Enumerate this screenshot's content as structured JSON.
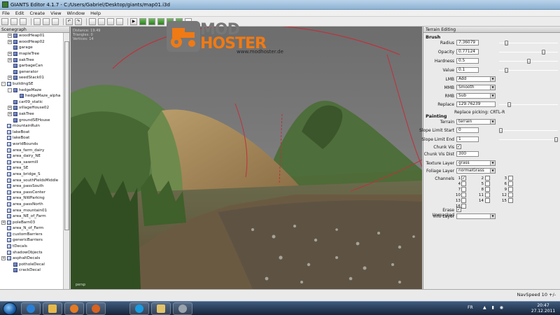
{
  "window": {
    "title": "GIANTS Editor 4.1.7 - C:/Users/Gabriel/Desktop/giants/map01.i3d"
  },
  "menu": [
    "File",
    "Edit",
    "Create",
    "View",
    "Window",
    "Help"
  ],
  "toolbar": {
    "icons": [
      "new-icon",
      "open-icon",
      "save-icon",
      "cut-icon",
      "copy-icon",
      "paste-icon",
      "undo-icon",
      "redo-icon",
      "select-icon",
      "move-icon",
      "rotate-icon",
      "scale-icon",
      "play-icon",
      "terrain-sculpt-icon",
      "terrain-paint-icon",
      "foliage-icon",
      "texture-icon",
      "grid-icon",
      "camera-icon"
    ]
  },
  "scenegraph": {
    "title": "Scenegraph",
    "items": [
      {
        "label": "woodHeap01",
        "indent": 1,
        "expander": "+",
        "icon": "node-icon"
      },
      {
        "label": "woodHeap02",
        "indent": 1,
        "expander": "+",
        "icon": "node-icon"
      },
      {
        "label": "garage",
        "indent": 1,
        "expander": "",
        "icon": "node-icon"
      },
      {
        "label": "mapleTree",
        "indent": 1,
        "expander": "+",
        "icon": "node-icon"
      },
      {
        "label": "oakTree",
        "indent": 1,
        "expander": "+",
        "icon": "node-icon"
      },
      {
        "label": "garbageCan",
        "indent": 1,
        "expander": "",
        "icon": "node-icon"
      },
      {
        "label": "generator",
        "indent": 1,
        "expander": "",
        "icon": "node-icon"
      },
      {
        "label": "seedStack01",
        "indent": 1,
        "expander": "+",
        "icon": "node-icon"
      },
      {
        "label": "buildingSE",
        "indent": 0,
        "expander": "-",
        "icon": "group-icon"
      },
      {
        "label": "hedgeMaze",
        "indent": 1,
        "expander": "-",
        "icon": "node-icon"
      },
      {
        "label": "hedgeMaze_alpha",
        "indent": 2,
        "expander": "",
        "icon": "node-icon"
      },
      {
        "label": "car09_static",
        "indent": 1,
        "expander": "",
        "icon": "node-icon"
      },
      {
        "label": "villageHouse02",
        "indent": 1,
        "expander": "+",
        "icon": "node-icon"
      },
      {
        "label": "oakTree",
        "indent": 1,
        "expander": "+",
        "icon": "node-icon"
      },
      {
        "label": "groundSEHouse",
        "indent": 1,
        "expander": "",
        "icon": "node-icon"
      },
      {
        "label": "mountainRuin",
        "indent": 0,
        "expander": "",
        "icon": "group-icon"
      },
      {
        "label": "lakeBoat",
        "indent": 0,
        "expander": "",
        "icon": "group-icon"
      },
      {
        "label": "lakeBoat",
        "indent": 0,
        "expander": "",
        "icon": "group-icon"
      },
      {
        "label": "worldBounds",
        "indent": 0,
        "expander": "",
        "icon": "group-icon"
      },
      {
        "label": "area_farm_dairy",
        "indent": 0,
        "expander": "",
        "icon": "group-icon"
      },
      {
        "label": "area_dairy_NE",
        "indent": 0,
        "expander": "",
        "icon": "group-icon"
      },
      {
        "label": "area_sawmill",
        "indent": 0,
        "expander": "",
        "icon": "group-icon"
      },
      {
        "label": "area_SE",
        "indent": 0,
        "expander": "",
        "icon": "group-icon"
      },
      {
        "label": "area_bridge_S",
        "indent": 0,
        "expander": "",
        "icon": "group-icon"
      },
      {
        "label": "area_southFieldsMiddle",
        "indent": 0,
        "expander": "",
        "icon": "group-icon"
      },
      {
        "label": "area_passSouth",
        "indent": 0,
        "expander": "",
        "icon": "group-icon"
      },
      {
        "label": "area_passCenter",
        "indent": 0,
        "expander": "",
        "icon": "group-icon"
      },
      {
        "label": "area_NWParking",
        "indent": 0,
        "expander": "",
        "icon": "group-icon"
      },
      {
        "label": "area_passNorth",
        "indent": 0,
        "expander": "",
        "icon": "group-icon"
      },
      {
        "label": "area_mountain01",
        "indent": 0,
        "expander": "",
        "icon": "group-icon"
      },
      {
        "label": "area_NE_of_Farm",
        "indent": 0,
        "expander": "",
        "icon": "group-icon"
      },
      {
        "label": "poleBarn03",
        "indent": 0,
        "expander": "+",
        "icon": "group-icon"
      },
      {
        "label": "area_N_of_Farm",
        "indent": 0,
        "expander": "",
        "icon": "group-icon"
      },
      {
        "label": "customBarriers",
        "indent": 0,
        "expander": "",
        "icon": "group-icon"
      },
      {
        "label": "genericBarriers",
        "indent": 0,
        "expander": "",
        "icon": "group-icon"
      },
      {
        "label": "tDecals",
        "indent": 0,
        "expander": "",
        "icon": "group-icon"
      },
      {
        "label": "shadowObjects",
        "indent": 0,
        "expander": "",
        "icon": "group-icon"
      },
      {
        "label": "asphaltDecals",
        "indent": 0,
        "expander": "+",
        "icon": "group-icon"
      },
      {
        "label": "potholeDecal",
        "indent": 1,
        "expander": "",
        "icon": "node-icon"
      },
      {
        "label": "crackDecal",
        "indent": 1,
        "expander": "",
        "icon": "node-icon"
      }
    ]
  },
  "viewport": {
    "stats": [
      "Distance: 19.49",
      "Triangles: 0",
      "Vertices: 14"
    ],
    "camera_label": "persp"
  },
  "watermark": {
    "mod": "MOD",
    "hoster": "HOSTER",
    "url": "www.modhoster.de"
  },
  "terrain": {
    "title": "Terrain Editing",
    "brush": {
      "section": "Brush",
      "radius_label": "Radius",
      "radius": "7.36079",
      "opacity_label": "Opacity",
      "opacity": "0.77124",
      "hardness_label": "Hardness",
      "hardness": "0.5",
      "value_label": "Value",
      "value": "0.1",
      "lmb_label": "LMB",
      "lmb": "Add",
      "mmb_label": "MMB",
      "mmb": "Smooth",
      "rmb_label": "RMB",
      "rmb": "Sub",
      "replace_label": "Replace",
      "replace": "129.76239",
      "replace_picking": "Replace picking: CRTL-R"
    },
    "painting": {
      "section": "Painting",
      "terrain_label": "Terrain",
      "terrain": "terrain",
      "slope_start_label": "Slope Limit Start",
      "slope_start": "0",
      "slope_end_label": "Slope Limit End",
      "slope_end": "1",
      "chunk_vis_label": "Chunk Vis",
      "chunk_vis_dist_label": "Chunk Vis Dist",
      "chunk_vis_dist": "300",
      "texture_layer_label": "Texture Layer",
      "texture_layer": "grass",
      "foliage_layer_label": "Foliage Layer",
      "foliage_layer": "normalGrass",
      "channels_label": "Channels",
      "channels": [
        "1",
        "2",
        "3",
        "4",
        "5",
        "6",
        "7",
        "8",
        "9",
        "10",
        "11",
        "12",
        "13",
        "14",
        "15",
        "16"
      ],
      "erase_unmasked_label": "Erase Unmasked",
      "info_layer_label": "Info Layer",
      "info_layer": ""
    },
    "sliders": {
      "radius": 0.1,
      "opacity": 0.77,
      "hardness": 0.5,
      "value": 0.1,
      "replace": 0.15,
      "slope_start": 0.0,
      "slope_end": 1.0
    },
    "checks": {
      "chunk_vis": true,
      "channel_1": true,
      "erase_unmasked": true
    }
  },
  "status": {
    "text": "NavSpeed 10 +/-"
  },
  "taskbar": {
    "apps": [
      "ie-icon",
      "folder-icon",
      "media-player-icon",
      "firefox-icon",
      "skype-icon",
      "giants-editor-icon",
      "chrome-icon"
    ],
    "lang": "FR",
    "time": "20:47",
    "date": "27.12.2011"
  }
}
